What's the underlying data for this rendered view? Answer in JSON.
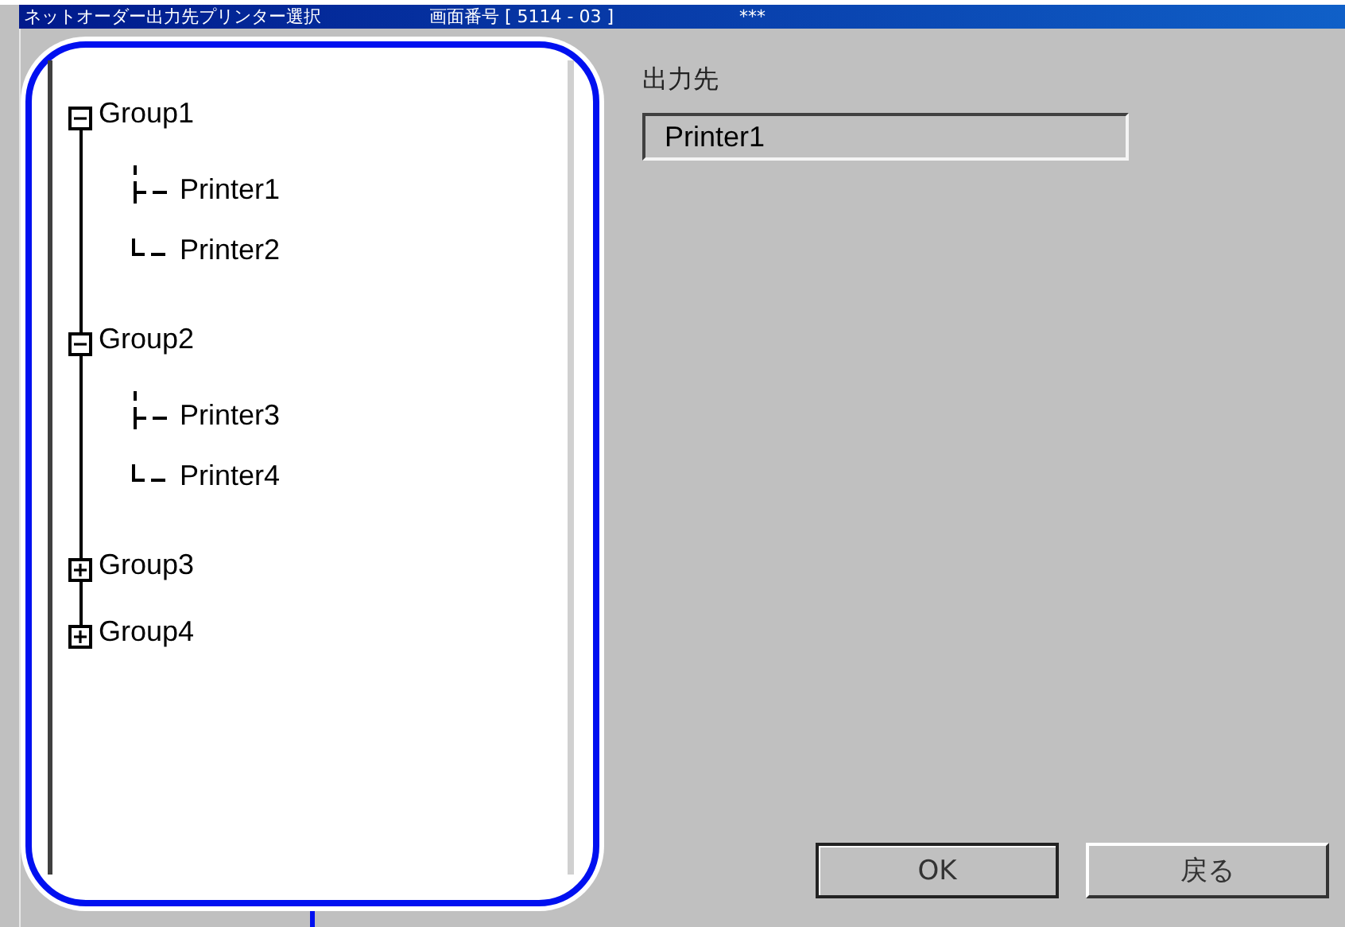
{
  "window": {
    "title": "ネットオーダー出力先プリンター選択",
    "screen_number": "画面番号 [ 5114 - 03 ]",
    "marker": "***"
  },
  "tree": [
    {
      "label": "Group1",
      "expanded": true,
      "children": [
        {
          "label": "Printer1"
        },
        {
          "label": "Printer2"
        }
      ]
    },
    {
      "label": "Group2",
      "expanded": true,
      "children": [
        {
          "label": "Printer3"
        },
        {
          "label": "Printer4"
        }
      ]
    },
    {
      "label": "Group3",
      "expanded": false
    },
    {
      "label": "Group4",
      "expanded": false
    }
  ],
  "output": {
    "label": "出力先",
    "value": "Printer1"
  },
  "buttons": [
    "OK",
    "戻る"
  ]
}
